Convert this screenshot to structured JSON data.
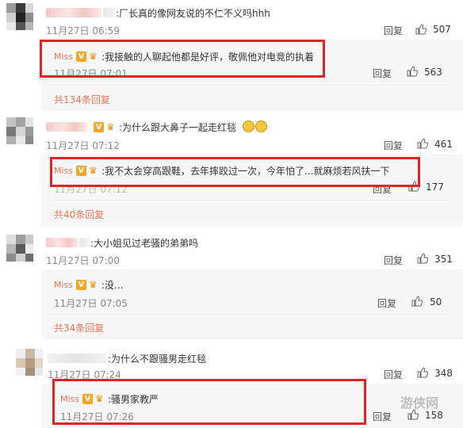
{
  "comments": [
    {
      "text": ":厂长真的像网友说的不仁不义吗hhh",
      "time": "11月27日 06:59",
      "reply_label": "回复",
      "likes": "507",
      "sub_reply": {
        "name": "Miss",
        "text": ":我接触的人聊起他都是好评，敬佩他对电竞的执着",
        "time": "11月27日 07:01",
        "reply_label": "回复",
        "likes": "563"
      },
      "more_replies": "共134条回复"
    },
    {
      "text": ":为什么跟大鼻子一起走红毯",
      "time": "11月27日 07:12",
      "reply_label": "回复",
      "likes": "461",
      "sub_reply": {
        "name": "Miss",
        "text": ":我不太会穿高跟鞋，去年摔跤过一次，今年怕了...就麻烦若风扶一下",
        "time": "11月27日 07:12",
        "reply_label": "回复",
        "likes": "177"
      },
      "more_replies": "共40条回复"
    },
    {
      "text": ":大小姐见过老骚的弟弟吗",
      "time": "11月27日 07:00",
      "reply_label": "回复",
      "likes": "351",
      "sub_reply": {
        "name": "Miss",
        "text": ":没...",
        "time": "11月27日 07:05",
        "reply_label": "回复",
        "likes": "50"
      },
      "more_replies": "共34条回复"
    },
    {
      "text": ":为什么不跟骚男走红毯",
      "time": "11月27日 07:24",
      "reply_label": "回复",
      "likes": "348",
      "sub_reply": {
        "name": "Miss",
        "text": ":骚男家教严",
        "time": "11月27日 07:26",
        "reply_label": "回复",
        "likes": "158"
      }
    }
  ],
  "verified_badge": "V",
  "watermark": "游侠网",
  "colors": {
    "highlight_box": "#e32424",
    "link": "#eb7350",
    "sub_background": "#f7f7f7"
  }
}
